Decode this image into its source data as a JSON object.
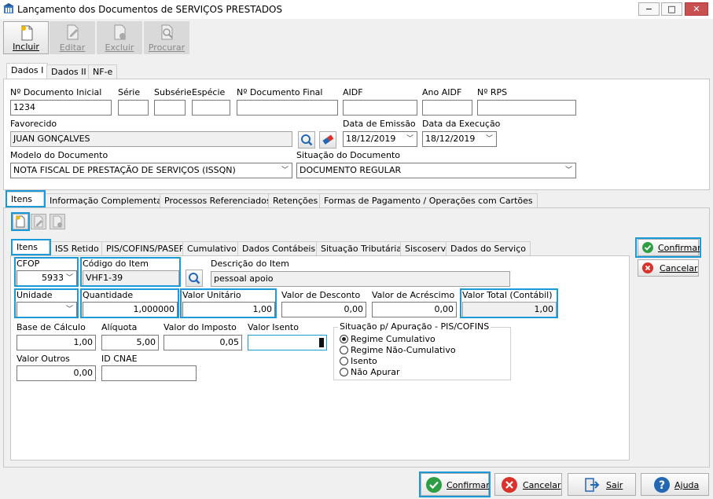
{
  "window": {
    "title": "Lançamento dos Documentos de SERVIÇOS PRESTADOS",
    "minimize": "−",
    "maximize": "□",
    "close": "✕"
  },
  "toolbar": {
    "incluir": "Incluir",
    "editar": "Editar",
    "excluir": "Excluir",
    "procurar": "Procurar"
  },
  "top_tabs": [
    "Dados I",
    "Dados II",
    "NF-e"
  ],
  "header": {
    "doc_inicial_label": "Nº Documento Inicial",
    "doc_inicial_value": "1234",
    "serie_label": "Série",
    "serie_value": "",
    "subserie_label": "Subsérie",
    "subserie_value": "",
    "especie_label": "Espécie",
    "especie_value": "",
    "doc_final_label": "Nº Documento Final",
    "doc_final_value": "",
    "aidf_label": "AIDF",
    "aidf_value": "",
    "ano_aidf_label": "Ano AIDF",
    "ano_aidf_value": "",
    "rps_label": "Nº RPS",
    "rps_value": "",
    "favorecido_label": "Favorecido",
    "favorecido_value": "JUAN GONÇALVES",
    "data_emissao_label": "Data de Emissão",
    "data_emissao_value": "18/12/2019",
    "data_execucao_label": "Data da Execução",
    "data_execucao_value": "18/12/2019",
    "modelo_label": "Modelo do Documento",
    "modelo_value": "NOTA FISCAL DE PRESTAÇÃO DE SERVIÇOS (ISSQN)",
    "situacao_label": "Situação do Documento",
    "situacao_value": "DOCUMENTO REGULAR"
  },
  "mid_tabs": [
    "Itens",
    "Informação Complementar",
    "Processos Referenciados",
    "Retenções",
    "Formas de Pagamento / Operações com Cartões"
  ],
  "item_tabs": [
    "Itens",
    "ISS Retido",
    "PIS/COFINS/PASEP",
    "Cumulativo",
    "Dados Contábeis",
    "Situação Tributária",
    "Siscoserv",
    "Dados do Serviço"
  ],
  "item": {
    "cfop_label": "CFOP",
    "cfop_value": "5933",
    "codigo_label": "Código do Item",
    "codigo_value": "VHF1-39",
    "descricao_label": "Descrição do Item",
    "descricao_value": "pessoal apoio",
    "unidade_label": "Unidade",
    "unidade_value": "",
    "quantidade_label": "Quantidade",
    "quantidade_value": "1,000000",
    "valor_unitario_label": "Valor Unitário",
    "valor_unitario_value": "1,00",
    "valor_desconto_label": "Valor de Desconto",
    "valor_desconto_value": "0,00",
    "valor_acrescimo_label": "Valor de Acréscimo",
    "valor_acrescimo_value": "0,00",
    "valor_total_label": "Valor Total (Contábil)",
    "valor_total_value": "1,00",
    "base_calculo_label": "Base de Cálculo",
    "base_calculo_value": "1,00",
    "aliquota_label": "Alíquota",
    "aliquota_value": "5,00",
    "valor_imposto_label": "Valor do Imposto",
    "valor_imposto_value": "0,05",
    "valor_isento_label": "Valor Isento",
    "valor_isento_value": "",
    "valor_outros_label": "Valor Outros",
    "valor_outros_value": "0,00",
    "id_cnae_label": "ID CNAE",
    "id_cnae_value": ""
  },
  "apuracao": {
    "title": "Situação p/ Apuração - PIS/COFINS",
    "options": [
      "Regime Cumulativo",
      "Regime Não-Cumulativo",
      "Isento",
      "Não Apurar"
    ],
    "selected": "Regime Cumulativo"
  },
  "side_buttons": {
    "confirmar": "Confirmar",
    "cancelar": "Cancelar"
  },
  "bottom_buttons": {
    "confirmar": "Confirmar",
    "cancelar": "Cancelar",
    "sair": "Sair",
    "ajuda": "Ajuda"
  },
  "colors": {
    "highlight": "#1a9bd7",
    "confirm_green": "#2e9e45",
    "cancel_red": "#d9322b",
    "help_blue": "#2468b3"
  }
}
